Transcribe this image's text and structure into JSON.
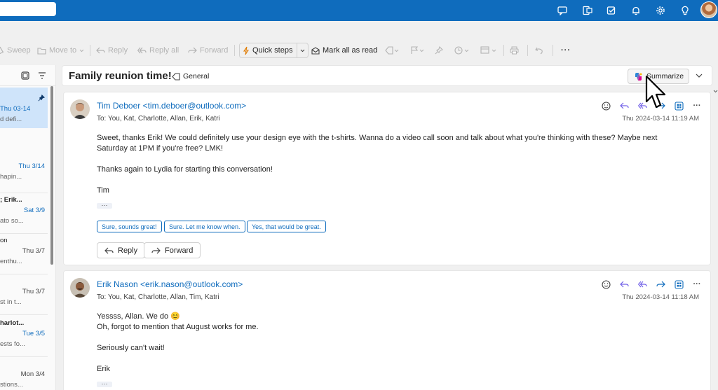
{
  "topbar": {
    "icons": [
      "chat-feedback-icon",
      "outlook-app-icon",
      "tasks-icon",
      "bell-icon",
      "gear-icon",
      "lightbulb-icon"
    ]
  },
  "toolbar": {
    "sweep": "Sweep",
    "move_to": "Move to",
    "reply": "Reply",
    "reply_all": "Reply all",
    "forward": "Forward",
    "quick_steps": "Quick steps",
    "mark_all_read": "Mark all as read",
    "more": "···"
  },
  "message_list": {
    "items": [
      {
        "date": "Thu 03-14",
        "preview": "d defi..."
      },
      {
        "date": "Thu 3/14",
        "preview": "hapin..."
      },
      {
        "from": "; Erik...",
        "date": "Sat 3/9",
        "preview": "ato so..."
      },
      {
        "from": "on",
        "date": "Thu 3/7",
        "preview": "enthu..."
      },
      {
        "date": "Thu 3/7",
        "preview": "st in t..."
      },
      {
        "from": "harlot...",
        "date": "Tue 3/5",
        "preview": "ests fo..."
      },
      {
        "date": "Mon 3/4",
        "preview": "stions..."
      }
    ]
  },
  "reading": {
    "subject": "Family reunion time!",
    "tag": "General",
    "summarize": "Summarize",
    "messages": [
      {
        "from": "Tim Deboer <tim.deboer@outlook.com>",
        "to": "To:  You, Kat, Charlotte, Allan, Erik, Katri",
        "date": "Thu 2024-03-14 11:19 AM",
        "body1": "Sweet, thanks Erik! We could definitely use your design eye with the t-shirts. Wanna do a video call soon and talk about what you're thinking with these? Maybe next\nSaturday at 1PM if you're free? LMK!",
        "body2": "Thanks again to Lydia for starting this conversation!",
        "body3": "Tim",
        "suggestions": [
          "Sure, sounds great!",
          "Sure. Let me know when.",
          "Yes, that would be great."
        ],
        "reply": "Reply",
        "forward": "Forward"
      },
      {
        "from": "Erik Nason <erik.nason@outlook.com>",
        "to": "To:  You, Kat, Charlotte, Allan, Tim, Katri",
        "date": "Thu 2024-03-14 11:18 AM",
        "body1": "Yessss, Allan. We do 😊\nOh, forgot to mention that August works for me.",
        "body2": "Seriously can't wait!",
        "body3": "Erik"
      }
    ]
  }
}
